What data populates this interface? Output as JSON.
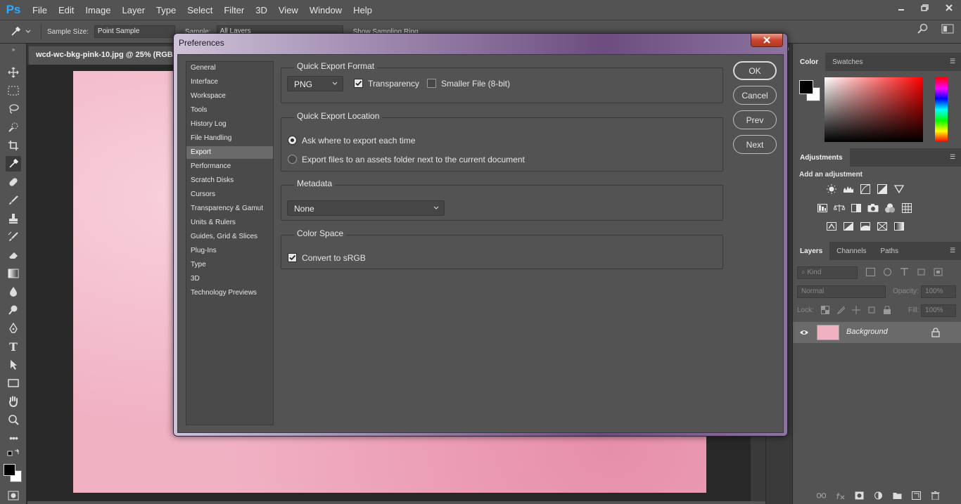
{
  "app": {
    "logo": "Ps",
    "menu": [
      "File",
      "Edit",
      "Image",
      "Layer",
      "Type",
      "Select",
      "Filter",
      "3D",
      "View",
      "Window",
      "Help"
    ],
    "window_controls": [
      "minimize-icon",
      "restore-icon",
      "close-icon"
    ]
  },
  "options_bar": {
    "sample_size_label": "Sample Size:",
    "sample_size_value": "Point Sample",
    "sample_label": "Sample:",
    "sample_value": "All Layers",
    "show_ring_label": "Show Sampling Ring"
  },
  "document": {
    "tab_title": "wcd-wc-bkg-pink-10.jpg @ 25% (RGB/8#)",
    "canvas_color": "#f0b1c3"
  },
  "panels": {
    "color_tabs": [
      "Color",
      "Swatches"
    ],
    "adjustments_tab": "Adjustments",
    "adjustments_title": "Add an adjustment",
    "layers_tabs": [
      "Layers",
      "Channels",
      "Paths"
    ],
    "layers_filter": "Kind",
    "blend_mode": "Normal",
    "opacity_label": "Opacity:",
    "opacity_value": "100%",
    "lock_label": "Lock:",
    "fill_label": "Fill:",
    "fill_value": "100%",
    "layer_name": "Background"
  },
  "dialog": {
    "title": "Preferences",
    "nav": [
      "General",
      "Interface",
      "Workspace",
      "Tools",
      "History Log",
      "File Handling",
      "Export",
      "Performance",
      "Scratch Disks",
      "Cursors",
      "Transparency & Gamut",
      "Units & Rulers",
      "Guides, Grid & Slices",
      "Plug-Ins",
      "Type",
      "3D",
      "Technology Previews"
    ],
    "active_nav": "Export",
    "quick_export_format": {
      "title": "Quick Export Format",
      "format_value": "PNG",
      "transparency_label": "Transparency",
      "transparency_checked": true,
      "smaller_file_label": "Smaller File (8-bit)",
      "smaller_file_checked": false
    },
    "quick_export_location": {
      "title": "Quick Export Location",
      "option_ask": "Ask where to export each time",
      "option_assets": "Export files to an assets folder next to the current document",
      "selected": "ask"
    },
    "metadata": {
      "title": "Metadata",
      "value": "None"
    },
    "color_space": {
      "title": "Color Space",
      "convert_label": "Convert to sRGB",
      "convert_checked": true
    },
    "buttons": {
      "ok": "OK",
      "cancel": "Cancel",
      "prev": "Prev",
      "next": "Next"
    }
  }
}
